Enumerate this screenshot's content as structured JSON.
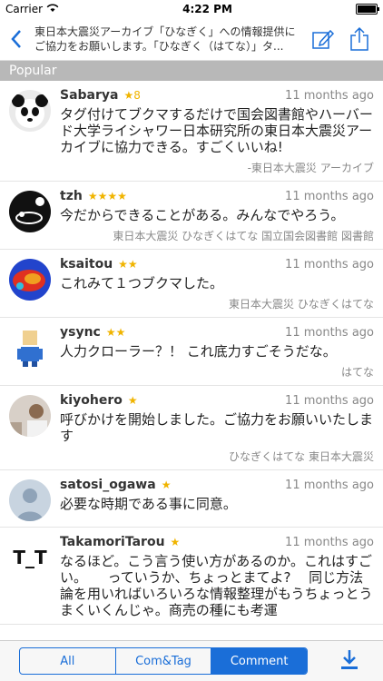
{
  "status": {
    "carrier": "Carrier",
    "time": "4:22 PM"
  },
  "nav": {
    "title": "東日本大震災アーカイブ「ひなぎく」への情報提供にご協力をお願いします。「ひなぎく（はてな）」タ..."
  },
  "section": {
    "label": "Popular"
  },
  "comments": [
    {
      "user": "Sabarya",
      "stars": "★8",
      "time": "11 months ago",
      "text": "タグ付けてブクマするだけで国会図書館やハーバード大学ライシャワー日本研究所の東日本大震災アーカイブに協力できる。すごくいいね!",
      "tags": "-東日本大震災 アーカイブ"
    },
    {
      "user": "tzh",
      "stars": "★★★★",
      "time": "11 months ago",
      "text": "今だからできることがある。みんなでやろう。",
      "tags": "東日本大震災 ひなぎくはてな 国立国会図書館 図書館"
    },
    {
      "user": "ksaitou",
      "stars": "★★",
      "time": "11 months ago",
      "text": "これみて１つブクマした。",
      "tags": "東日本大震災 ひなぎくはてな"
    },
    {
      "user": "ysync",
      "stars": "★★",
      "time": "11 months ago",
      "text": "人力クローラー？！ これ底力すごそうだな。",
      "tags": "はてな"
    },
    {
      "user": "kiyohero",
      "stars": "★",
      "time": "11 months ago",
      "text": "呼びかけを開始しました。ご協力をお願いいたします",
      "tags": "ひなぎくはてな 東日本大震災"
    },
    {
      "user": "satosi_ogawa",
      "stars": "★",
      "time": "11 months ago",
      "text": "必要な時期である事に同意。",
      "tags": ""
    },
    {
      "user": "TakamoriTarou",
      "stars": "★",
      "time": "11 months ago",
      "text": "なるほど。こう言う使い方があるのか。これはすごい。　　っていうか、ちょっとまてよ?　 同じ方法論を用いればいろいろな情報整理がもうちょっとうまくいくんじゃ。商売の種にも考運",
      "tags": ""
    }
  ],
  "avatar_tt": "T_T",
  "tabs": {
    "all": "All",
    "comtag": "Com&Tag",
    "comment": "Comment"
  },
  "colors": {
    "accent": "#1a6ed8",
    "star": "#f0b400"
  }
}
